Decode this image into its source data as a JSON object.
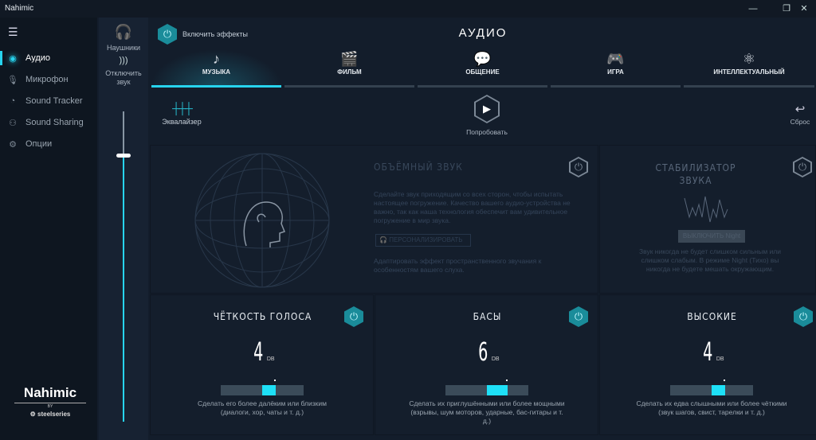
{
  "window": {
    "title": "Nahimic",
    "controls": [
      "—",
      "❐",
      "✕"
    ]
  },
  "sidebar": {
    "menu_icon": "hamburger-icon",
    "items": [
      {
        "label": "Аудио",
        "icon": "audio-waves-icon",
        "active": true
      },
      {
        "label": "Микрофон",
        "icon": "microphone-icon"
      },
      {
        "label": "Sound Tracker",
        "icon": "radar-icon"
      },
      {
        "label": "Sound Sharing",
        "icon": "share-icon"
      },
      {
        "label": "Опции",
        "icon": "gear-icon"
      }
    ],
    "logo": {
      "brand": "Nahimic",
      "by": "BY",
      "partner": "steelseries"
    }
  },
  "volume": {
    "device_label": "Наушники",
    "mute_label": "Отключить звук",
    "level_percent": 86,
    "accent": "#27d4ee"
  },
  "header": {
    "effects_toggle_label": "Включить эффекты",
    "title": "АУДИО"
  },
  "tabs": [
    {
      "label": "МУЗЫКА",
      "icon": "music-note-icon",
      "active": true
    },
    {
      "label": "ФИЛЬМ",
      "icon": "clapperboard-icon"
    },
    {
      "label": "ОБЩЕНИЕ",
      "icon": "chat-bubbles-icon"
    },
    {
      "label": "ИГРА",
      "icon": "gamepad-icon"
    },
    {
      "label": "ИНТЕЛЛЕКТУАЛЬНЫЙ",
      "icon": "atom-icon"
    }
  ],
  "toolbar": {
    "equalizer_label": "Эквалайзер",
    "try_label": "Попробовать",
    "reset_label": "Сброс"
  },
  "surround": {
    "title": "ОБЪЁМНЫЙ ЗВУК",
    "enabled": false,
    "description": "Сделайте звук приходящим со всех сторон, чтобы испытать настоящее погружение. Качество вашего аудио-устройства не важно, так как наша технология обеспечит вам удивительное погружение в мир звука.",
    "personalize_label": "ПЕРСОНАЛИЗИРОВАТЬ",
    "note": "Адаптировать эффект пространственного звучания к особенностям вашего слуха."
  },
  "stabilizer": {
    "title": "СТАБИЛИЗАТОР ЗВУКА",
    "enabled": false,
    "night_button": "ВЫКЛЮЧИТЬ Night",
    "description": "Звук никогда не будет слишком сильным или слишком слабым. В режиме Night (Тихо) вы никогда не будете мешать окружающим."
  },
  "effects": [
    {
      "title": "ЧЁТКОСТЬ ГОЛОСА",
      "value": 4,
      "unit": "DB",
      "enabled": true,
      "description": "Сделать его более далёким или близким (диалоги, хор, чаты и т. д.)"
    },
    {
      "title": "БАСЫ",
      "value": 6,
      "unit": "DB",
      "enabled": true,
      "description": "Сделать их приглушёнными или более мощными (взрывы, шум моторов, ударные, бас-гитары и т. д.)"
    },
    {
      "title": "ВЫСОКИЕ",
      "value": 4,
      "unit": "DB",
      "enabled": true,
      "description": "Сделать их едва слышными или более чёткими (звук шагов, свист, тарелки и т. д.)"
    }
  ]
}
